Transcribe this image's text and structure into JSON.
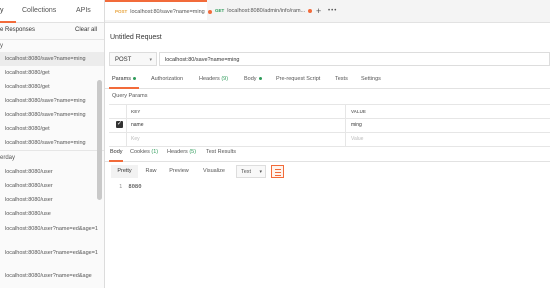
{
  "sidebar": {
    "tabs": [
      "y",
      "Collections",
      "APIs"
    ],
    "header": {
      "title": "e Responses",
      "clear_label": "Clear all"
    },
    "groups": [
      {
        "title": "y",
        "items": [
          "localhost:8080/save?name=ming",
          "localhost:8080/get",
          "localhost:8080/get",
          "localhost:8080/save?name=ming",
          "localhost:8080/save?name=ming",
          "localhost:8080/get",
          "localhost:8080/save?name=ming"
        ]
      },
      {
        "title": "erday",
        "items": [
          "localhost:8080/user",
          "localhost:8080/user",
          "localhost:8080/user",
          "localhost:8080/use",
          "localhost:8080/user?name=ed&age=1",
          "localhost:8080/user?name=ed&age=1",
          "localhost:8080/user?name=ed&age"
        ]
      }
    ]
  },
  "tabs": [
    {
      "method": "POST",
      "label": "localhost:80/save?name=ming"
    },
    {
      "method": "GET",
      "label": "localhost:8080/admin/info/ram..."
    }
  ],
  "icons": {
    "plus": "+",
    "more": "•••",
    "check": "✓",
    "chevron": "▾"
  },
  "request": {
    "name": "Untitled Request",
    "method": "POST",
    "url": "localhost:80/save?name=ming"
  },
  "req_tabs": {
    "params": "Params",
    "authorization": "Authorization",
    "headers": "Headers",
    "headers_count": "(9)",
    "body": "Body",
    "prerequest": "Pre-request Script",
    "tests": "Tests",
    "settings": "Settings"
  },
  "params": {
    "title": "Query Params",
    "col_key": "KEY",
    "col_value": "VALUE",
    "rows": [
      {
        "key": "name",
        "value": "ming"
      }
    ],
    "placeholder_key": "Key",
    "placeholder_value": "Value"
  },
  "response": {
    "tabs": {
      "body": "Body",
      "cookies": "Cookies",
      "cookies_count": "(1)",
      "headers": "Headers",
      "headers_count": "(5)",
      "test_results": "Test Results"
    },
    "formats": [
      "Pretty",
      "Raw",
      "Preview",
      "Visualize"
    ],
    "format_type": "Text",
    "lines": [
      {
        "num": "1",
        "text": "8080"
      }
    ]
  },
  "colors": {
    "accent": "#f26b3a",
    "post": "#e8a33b",
    "get": "#2e9b5a"
  }
}
